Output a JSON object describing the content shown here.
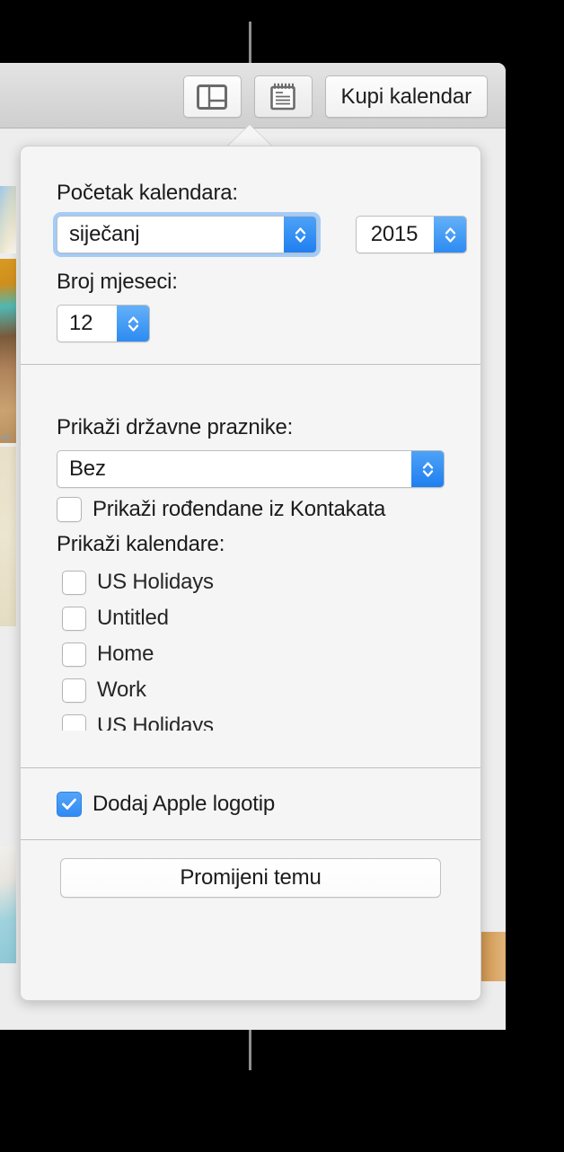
{
  "window": {
    "toolbar": {
      "layout_button_icon": "split-layout-icon",
      "notebook_button_icon": "notebook-icon",
      "buy_calendar_label": "Kupi kalendar"
    }
  },
  "popover": {
    "start_section": {
      "start_label": "Početak kalendara:",
      "month_value": "siječanj",
      "year_value": "2015",
      "months_label": "Broj mjeseci:",
      "months_value": "12"
    },
    "holidays_section": {
      "holidays_label": "Prikaži državne praznike:",
      "holidays_value": "Bez",
      "birthdays_label": "Prikaži rođendane iz Kontakata",
      "birthdays_checked": false,
      "calendars_label": "Prikaži kalendare:",
      "calendars": [
        {
          "label": "US Holidays",
          "checked": false
        },
        {
          "label": "Untitled",
          "checked": false
        },
        {
          "label": "Home",
          "checked": false
        },
        {
          "label": "Work",
          "checked": false
        },
        {
          "label": "US Holidays",
          "checked": false
        }
      ]
    },
    "logo_section": {
      "apple_logo_label": "Dodaj Apple logotip",
      "apple_logo_checked": true
    },
    "footer": {
      "change_theme_label": "Promijeni temu"
    }
  },
  "colors": {
    "accent_blue": "#2f8bf3",
    "popover_bg": "#f5f5f5",
    "toolbar_bg": "#d8d8d8",
    "divider": "#bfbfbf",
    "text": "#1b1b1b"
  }
}
